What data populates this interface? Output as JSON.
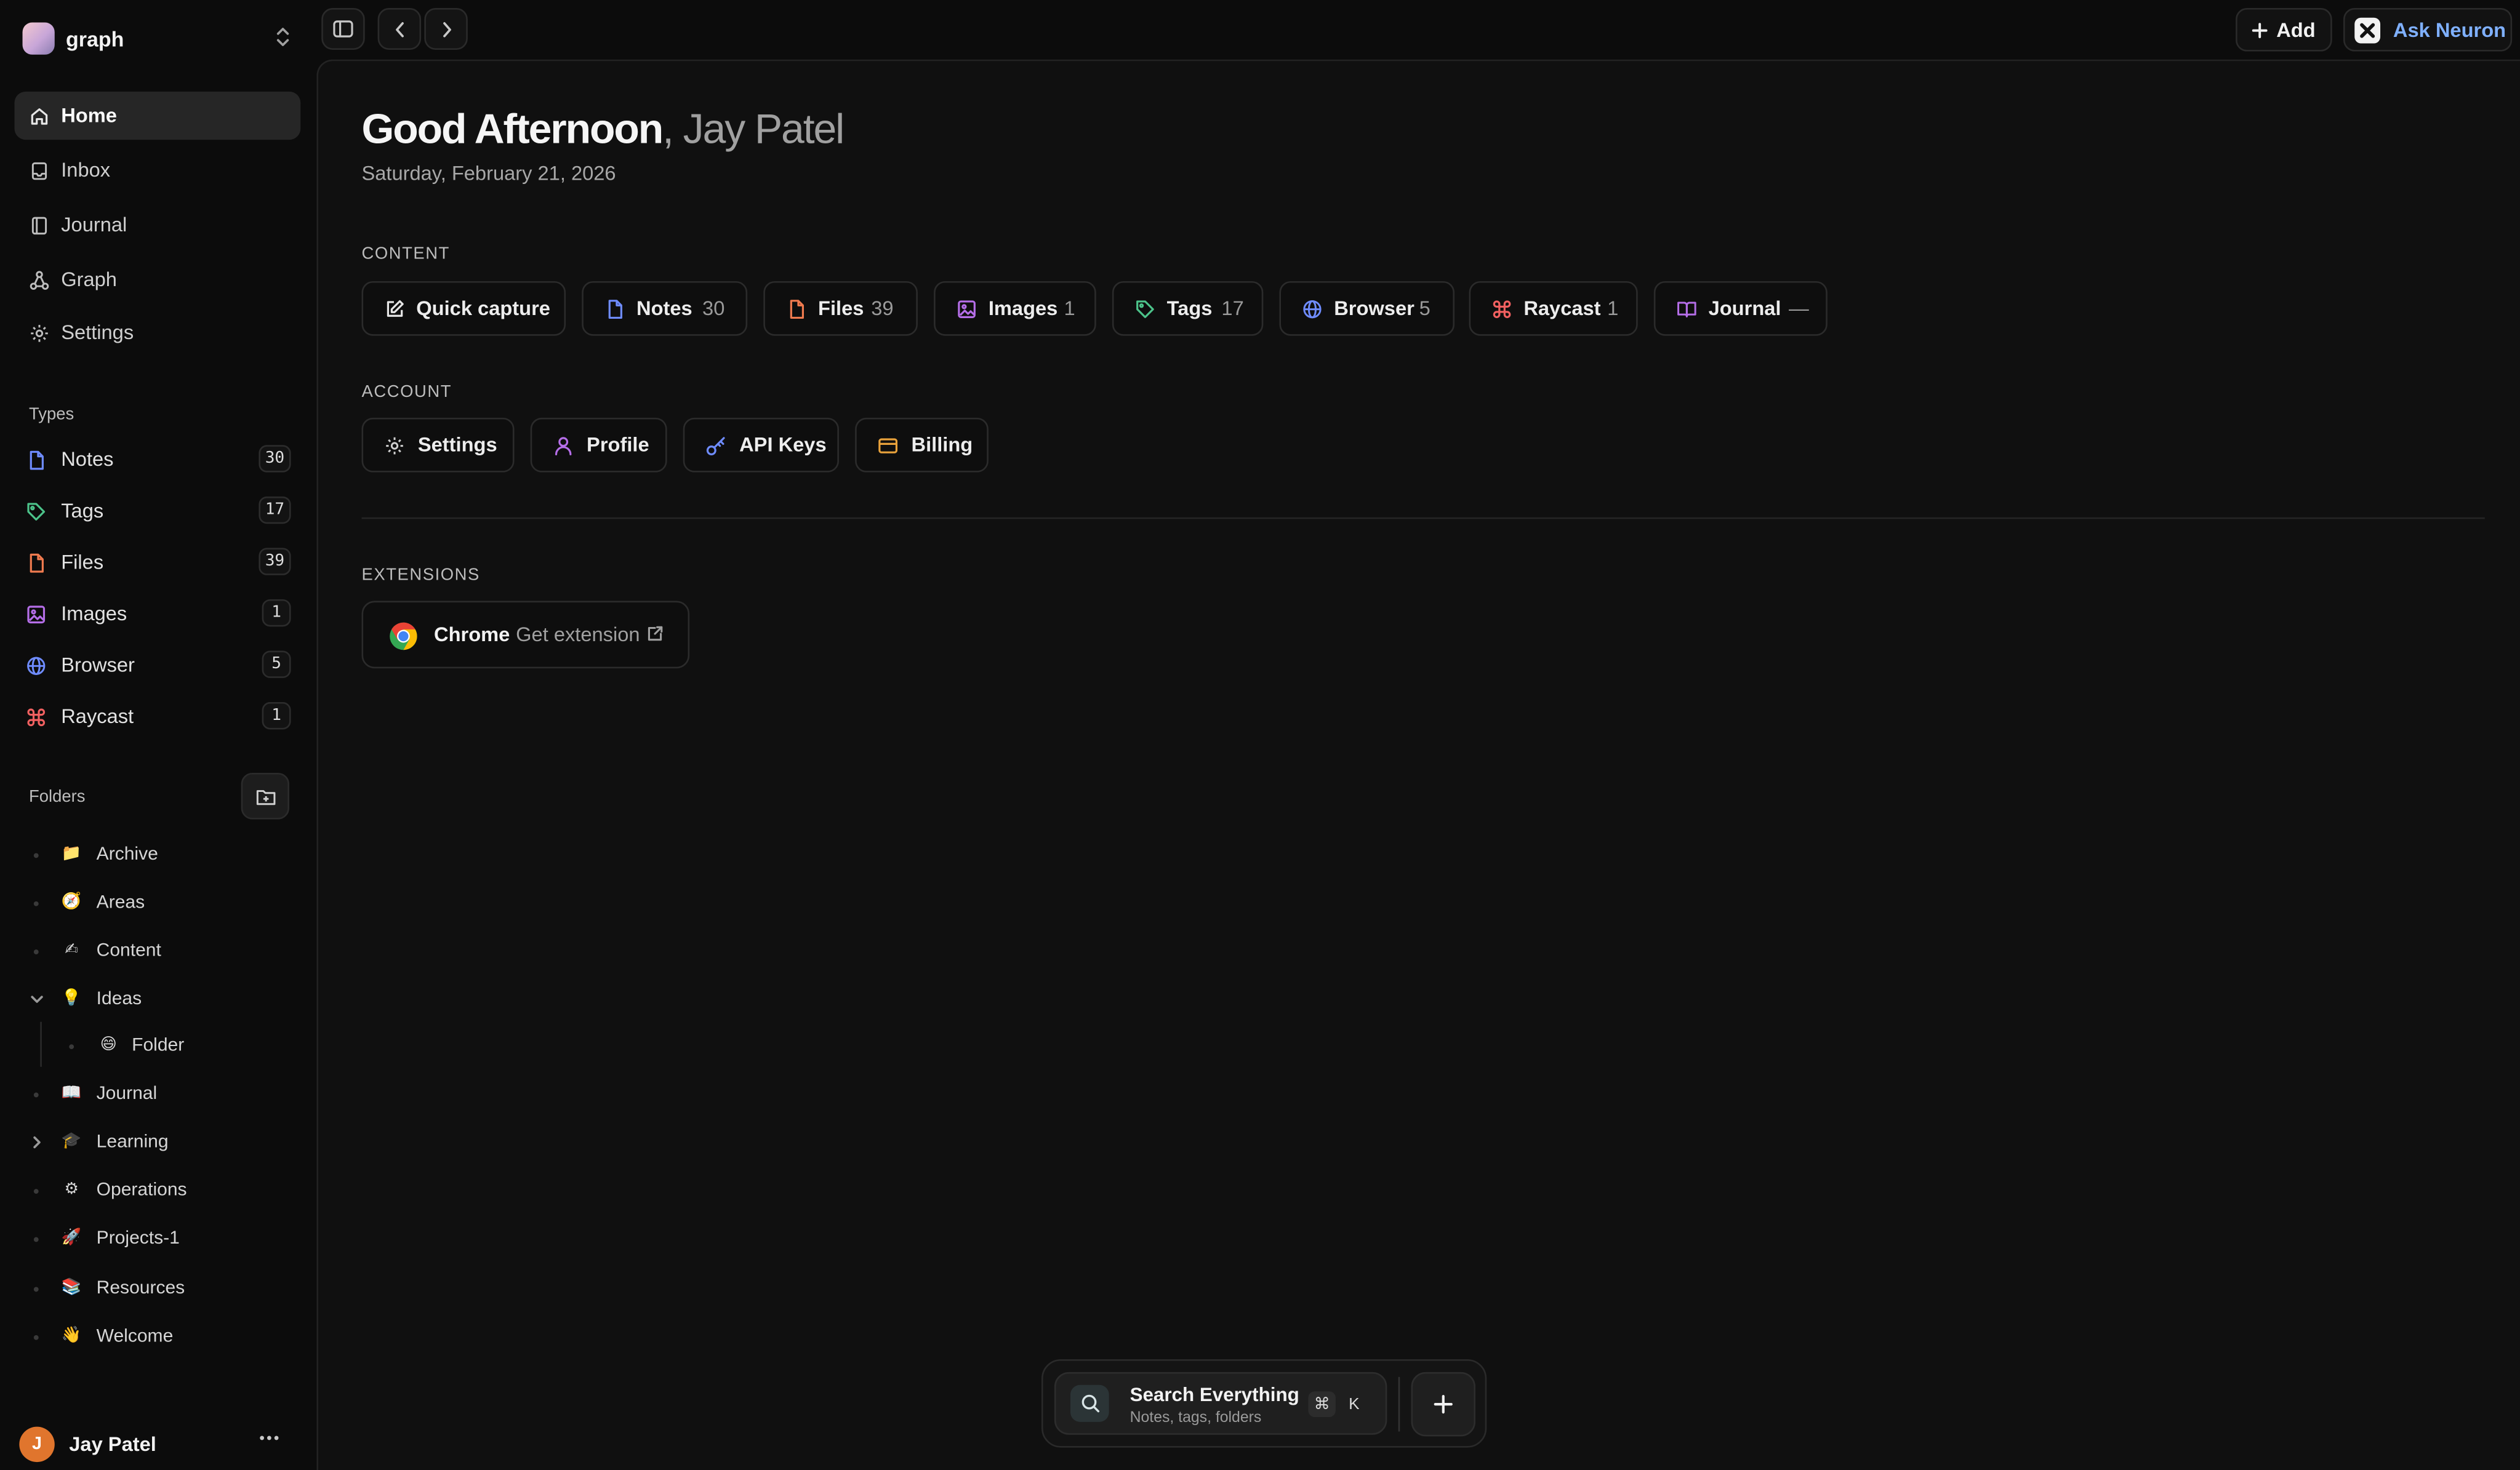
{
  "workspace": {
    "name": "graph"
  },
  "nav": [
    {
      "label": "Home",
      "active": true
    },
    {
      "label": "Inbox"
    },
    {
      "label": "Journal"
    },
    {
      "label": "Graph"
    },
    {
      "label": "Settings"
    }
  ],
  "types": {
    "title": "Types",
    "items": [
      {
        "label": "Notes",
        "count": "30",
        "color": "#6f8cff"
      },
      {
        "label": "Tags",
        "count": "17",
        "color": "#4cc38a"
      },
      {
        "label": "Files",
        "count": "39",
        "color": "#f07b4f"
      },
      {
        "label": "Images",
        "count": "1",
        "color": "#b56ee8"
      },
      {
        "label": "Browser",
        "count": "5",
        "color": "#6f8cff"
      },
      {
        "label": "Raycast",
        "count": "1",
        "color": "#f06060"
      }
    ]
  },
  "folders": {
    "title": "Folders",
    "items": [
      {
        "label": "Archive",
        "icon": "file-folder-emoji"
      },
      {
        "label": "Areas",
        "icon": "compass-emoji"
      },
      {
        "label": "Content",
        "icon": "writing-hand-emoji"
      },
      {
        "label": "Ideas",
        "icon": "light-bulb-emoji",
        "expanded": true
      },
      {
        "label": "Folder",
        "icon": "grinning-face-emoji",
        "child": true
      },
      {
        "label": "Journal",
        "icon": "open-book-emoji"
      },
      {
        "label": "Learning",
        "icon": "graduation-cap-emoji",
        "collapsed": true
      },
      {
        "label": "Operations",
        "icon": "gear-emoji"
      },
      {
        "label": "Projects-1",
        "icon": "rocket-emoji"
      },
      {
        "label": "Resources",
        "icon": "books-emoji"
      },
      {
        "label": "Welcome",
        "icon": "waving-hand-emoji"
      }
    ]
  },
  "user": {
    "initial": "J",
    "name": "Jay Patel"
  },
  "topbar": {
    "add_label": "Add",
    "ask_label": "Ask Neuron"
  },
  "main": {
    "greeting": "Good Afternoon",
    "greeting_name": ", Jay Patel",
    "date": "Saturday, February 21, 2026",
    "content_title": "CONTENT",
    "content_items": [
      {
        "label": "Quick capture",
        "count": ""
      },
      {
        "label": "Notes",
        "count": "30"
      },
      {
        "label": "Files",
        "count": "39"
      },
      {
        "label": "Images",
        "count": "1"
      },
      {
        "label": "Tags",
        "count": "17"
      },
      {
        "label": "Browser",
        "count": "5"
      },
      {
        "label": "Raycast",
        "count": "1"
      },
      {
        "label": "Journal",
        "count": "—"
      }
    ],
    "account_title": "ACCOUNT",
    "account_items": [
      {
        "label": "Settings"
      },
      {
        "label": "Profile"
      },
      {
        "label": "API Keys"
      },
      {
        "label": "Billing"
      }
    ],
    "extensions_title": "EXTENSIONS",
    "extension": {
      "name": "Chrome",
      "action": "Get extension"
    }
  },
  "search": {
    "title": "Search Everything",
    "subtitle": "Notes, tags, folders",
    "shortcut_mod": "⌘",
    "shortcut_key": "K"
  }
}
